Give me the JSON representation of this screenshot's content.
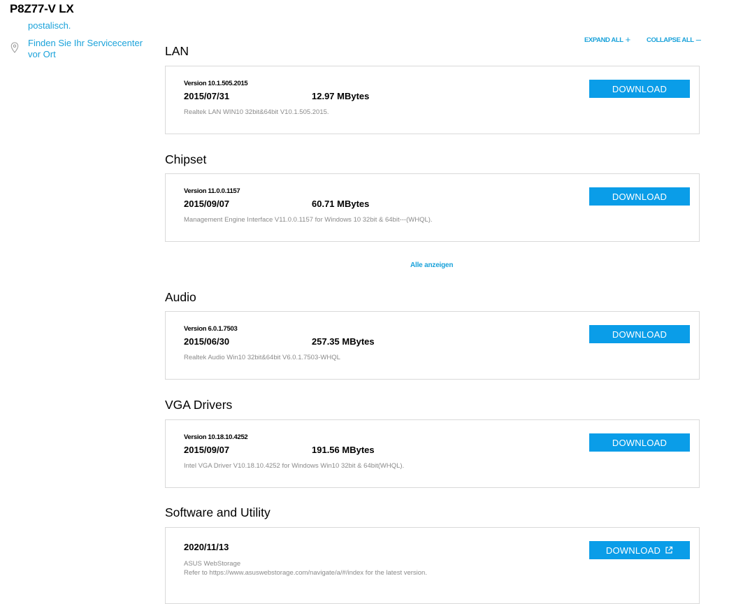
{
  "product": {
    "title": "P8Z77-V LX"
  },
  "sidebar": {
    "postal_text": "postalisch.",
    "service_center_text": "Finden Sie Ihr Servicecenter vor Ort",
    "service_center_icon": "location-pin-icon"
  },
  "toolbar": {
    "expand_all": "EXPAND ALL",
    "expand_glyph": "+",
    "collapse_all": "COLLAPSE ALL",
    "collapse_glyph": "–"
  },
  "sections": [
    {
      "title": "LAN",
      "item": {
        "version": "Version 10.1.505.2015",
        "date": "2015/07/31",
        "size": "12.97 MBytes",
        "description": "Realtek LAN WIN10 32bit&64bit V10.1.505.2015.",
        "button": "DOWNLOAD"
      }
    },
    {
      "title": "Chipset",
      "item": {
        "version": "Version 11.0.0.1157",
        "date": "2015/09/07",
        "size": "60.71 MBytes",
        "description": "Management Engine Interface V11.0.0.1157 for Windows 10 32bit & 64bit---(WHQL).",
        "button": "DOWNLOAD"
      }
    },
    {
      "title": "Audio",
      "item": {
        "version": "Version 6.0.1.7503",
        "date": "2015/06/30",
        "size": "257.35 MBytes",
        "description": "Realtek Audio Win10 32bit&64bit V6.0.1.7503-WHQL",
        "button": "DOWNLOAD"
      }
    },
    {
      "title": "VGA Drivers",
      "item": {
        "version": "Version 10.18.10.4252",
        "date": "2015/09/07",
        "size": "191.56 MBytes",
        "description": "Intel VGA Driver V10.18.10.4252 for Windows Win10 32bit & 64bit(WHQL).",
        "button": "DOWNLOAD"
      }
    },
    {
      "title": "Software and Utility",
      "item": {
        "date": "2020/11/13",
        "description_line1": "ASUS WebStorage",
        "description_line2": "Refer to https://www.asuswebstorage.com/navigate/a/#/index for the latest version.",
        "button": "DOWNLOAD",
        "button_icon": "external-link-icon"
      }
    }
  ],
  "show_all": "Alle anzeigen",
  "colors": {
    "accent": "#1aa2da",
    "button": "#0a9de8",
    "border": "#d9d9d9"
  }
}
